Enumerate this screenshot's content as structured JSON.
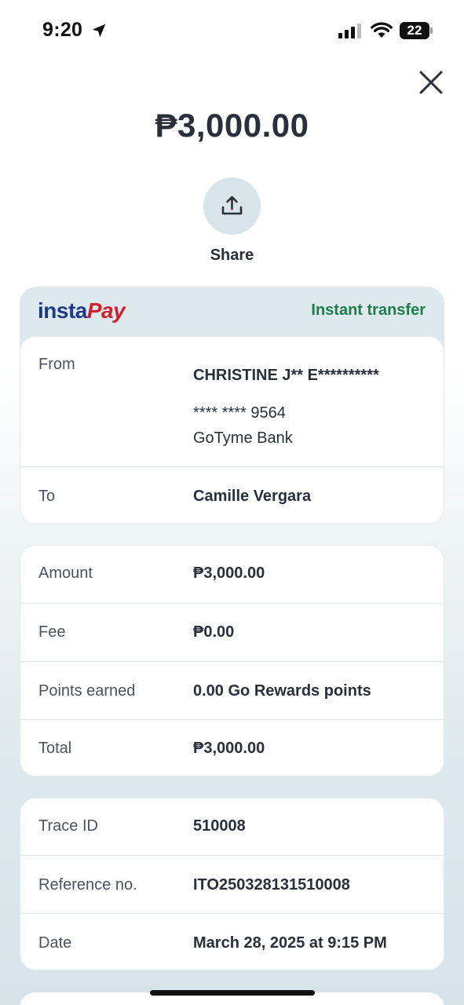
{
  "status_bar": {
    "time": "9:20",
    "battery": "22"
  },
  "header": {
    "amount": "₱3,000.00",
    "share_label": "Share"
  },
  "network": {
    "logo_part1": "insta",
    "logo_part2": "Pay",
    "transfer_type": "Instant transfer",
    "accent_color": "#1e7d4a"
  },
  "parties": {
    "from_label": "From",
    "from_name": "CHRISTINE J** E**********",
    "from_account": "**** **** 9564",
    "from_bank": "GoTyme Bank",
    "to_label": "To",
    "to_name": "Camille Vergara"
  },
  "breakdown": {
    "amount_label": "Amount",
    "amount_value": "₱3,000.00",
    "fee_label": "Fee",
    "fee_value": "₱0.00",
    "points_label": "Points earned",
    "points_value": "0.00 Go Rewards points",
    "total_label": "Total",
    "total_value": "₱3,000.00"
  },
  "details": {
    "trace_label": "Trace ID",
    "trace_value": "510008",
    "reference_label": "Reference no.",
    "reference_value": "ITO250328131510008",
    "date_label": "Date",
    "date_value": "March 28, 2025 at 9:15 PM"
  }
}
